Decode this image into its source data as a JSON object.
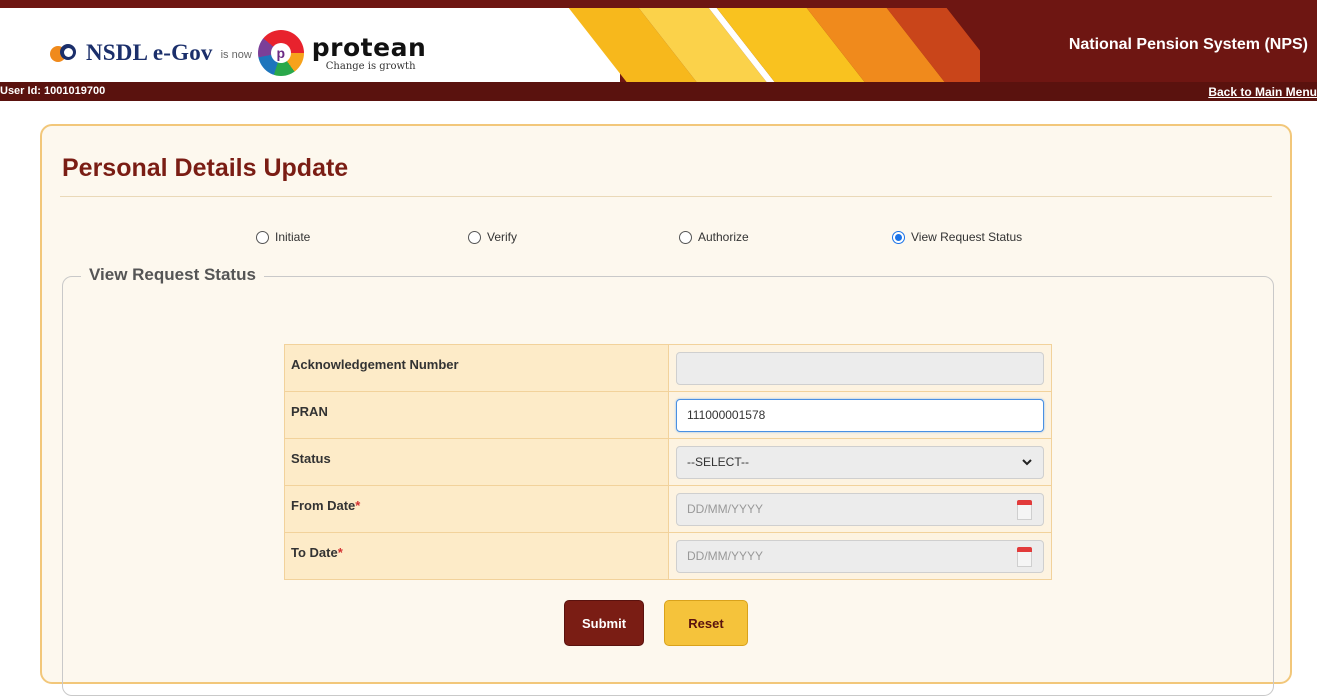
{
  "header": {
    "brand_text": "NSDL e-Gov",
    "is_now_text": "is now",
    "protean_name": "protean",
    "protean_tagline": "Change is growth",
    "system_title": "National Pension System (NPS)",
    "colors": {
      "maroon": "#6e1612",
      "stripe_yellow": "#f5c33b",
      "stripe_orange": "#f08a1c"
    }
  },
  "subbar": {
    "user_id": "User Id: 1001019700",
    "back_link": "Back to Main Menu"
  },
  "page": {
    "title": "Personal Details Update",
    "radios": [
      {
        "label": "Initiate",
        "checked": false
      },
      {
        "label": "Verify",
        "checked": false
      },
      {
        "label": "Authorize",
        "checked": false
      },
      {
        "label": "View Request Status",
        "checked": true
      }
    ],
    "section_legend": "View Request Status"
  },
  "form": {
    "ack_label": "Acknowledgement Number",
    "ack_value": "",
    "pran_label": "PRAN",
    "pran_value": "111000001578",
    "status_label": "Status",
    "status_selected": "--SELECT--",
    "from_date_label": "From Date",
    "from_date_placeholder": "DD/MM/YYYY",
    "to_date_label": "To Date",
    "to_date_placeholder": "DD/MM/YYYY",
    "required_mark": "*"
  },
  "buttons": {
    "submit": "Submit",
    "reset": "Reset"
  }
}
